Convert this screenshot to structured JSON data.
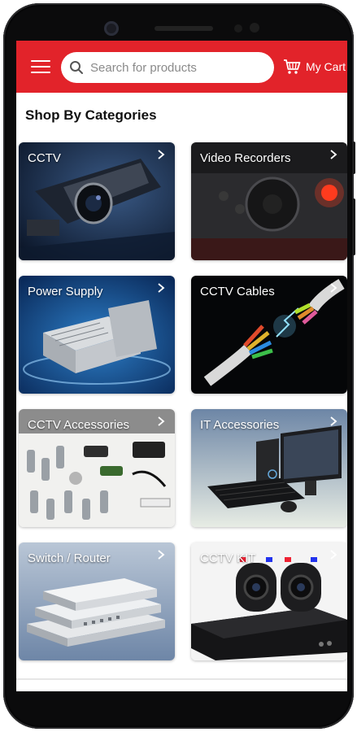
{
  "header": {
    "menu_icon": "hamburger-menu-icon",
    "search_placeholder": "Search for products",
    "search_icon": "search-icon",
    "cart_icon": "shopping-cart-icon",
    "cart_label": "My Cart",
    "bg_color": "#e2232a"
  },
  "section": {
    "title": "Shop By Categories"
  },
  "categories": [
    {
      "label": "CCTV"
    },
    {
      "label": "Video Recorders"
    },
    {
      "label": "Power Supply"
    },
    {
      "label": "CCTV Cables"
    },
    {
      "label": "CCTV Accessories"
    },
    {
      "label": "IT Accessories"
    },
    {
      "label": "Switch / Router"
    },
    {
      "label": "CCTV KIT"
    }
  ]
}
